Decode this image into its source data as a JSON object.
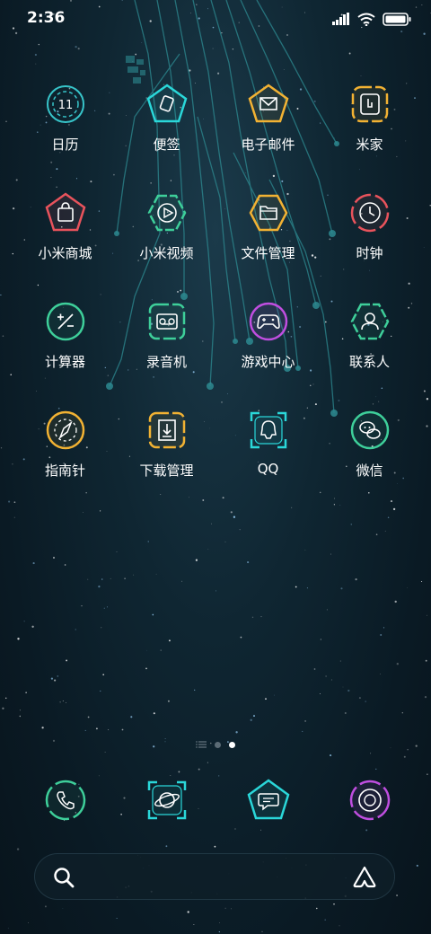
{
  "status_bar": {
    "time": "2:36"
  },
  "apps": [
    {
      "label": "日历",
      "icon": "calendar-icon",
      "color": "#37c4c9",
      "badge_text": "11"
    },
    {
      "label": "便签",
      "icon": "notes-icon",
      "color": "#2ad7d9"
    },
    {
      "label": "电子邮件",
      "icon": "mail-icon",
      "color": "#f2b233"
    },
    {
      "label": "米家",
      "icon": "mijia-icon",
      "color": "#f2b233"
    },
    {
      "label": "小米商城",
      "icon": "shop-bag-icon",
      "color": "#e9535c"
    },
    {
      "label": "小米视频",
      "icon": "video-play-icon",
      "color": "#3ecf9a"
    },
    {
      "label": "文件管理",
      "icon": "folder-icon",
      "color": "#f2b233"
    },
    {
      "label": "时钟",
      "icon": "clock-icon",
      "color": "#e9535c"
    },
    {
      "label": "计算器",
      "icon": "calculator-icon",
      "color": "#3ecf9a"
    },
    {
      "label": "录音机",
      "icon": "recorder-icon",
      "color": "#3ecf9a"
    },
    {
      "label": "游戏中心",
      "icon": "gamepad-icon",
      "color": "#c04ee0"
    },
    {
      "label": "联系人",
      "icon": "contacts-icon",
      "color": "#3ecf9a"
    },
    {
      "label": "指南针",
      "icon": "compass-icon",
      "color": "#f2b233"
    },
    {
      "label": "下载管理",
      "icon": "download-icon",
      "color": "#f2b233"
    },
    {
      "label": "QQ",
      "icon": "qq-icon",
      "color": "#2ad7d9"
    },
    {
      "label": "微信",
      "icon": "wechat-icon",
      "color": "#3ecf9a"
    }
  ],
  "page_indicator": {
    "pages": 2,
    "active_index": 1
  },
  "dock": [
    {
      "icon": "phone-icon",
      "color": "#3ecf9a"
    },
    {
      "icon": "browser-icon",
      "color": "#2ad7d9"
    },
    {
      "icon": "messages-icon",
      "color": "#2ad7d9"
    },
    {
      "icon": "camera-icon",
      "color": "#c04ee0"
    }
  ]
}
